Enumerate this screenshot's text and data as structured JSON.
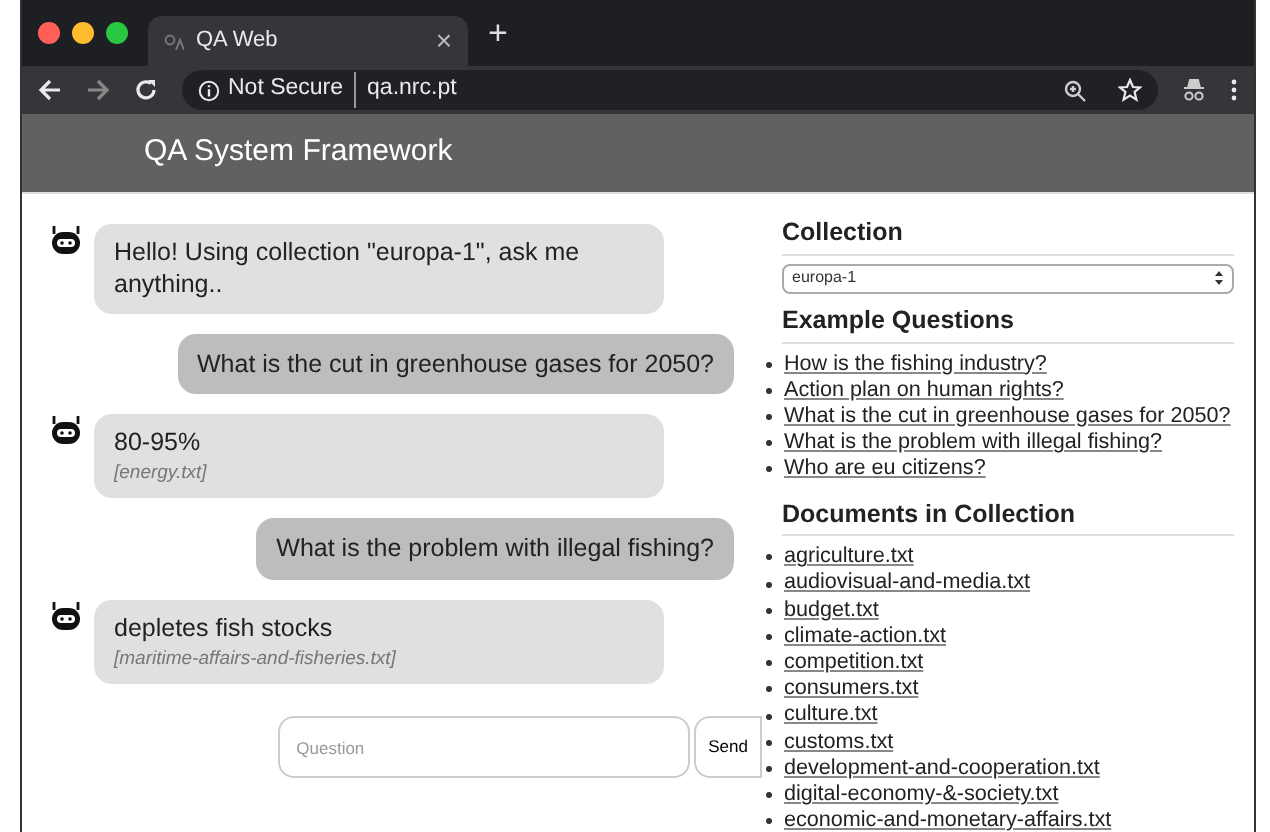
{
  "browser": {
    "tab_title": "QA Web",
    "tab_close": "×",
    "new_tab": "+",
    "security": "Not Secure",
    "url": "qa.nrc.pt"
  },
  "header": {
    "title": "QA System Framework"
  },
  "chat": {
    "messages": [
      {
        "kind": "bot",
        "text": "Hello! Using collection \"europa-1\", ask me anything.."
      },
      {
        "kind": "user",
        "text": "What is the cut in greenhouse gases for 2050?"
      },
      {
        "kind": "bot",
        "text": "80-95%",
        "source": "[energy.txt]"
      },
      {
        "kind": "user",
        "text": "What is the problem with illegal fishing?"
      },
      {
        "kind": "bot",
        "text": "depletes fish stocks",
        "source": "[maritime-affairs-and-fisheries.txt]"
      }
    ],
    "input": {
      "placeholder": "Question"
    },
    "send_button": "Send"
  },
  "sidebar": {
    "collection_heading": "Collection",
    "collection_value": "europa-1",
    "examples_heading": "Example Questions",
    "examples": [
      "How is the fishing industry?",
      "Action plan on human rights?",
      "What is the cut in greenhouse gases for 2050?",
      "What is the problem with illegal fishing?",
      "Who are eu citizens?"
    ],
    "documents_heading": "Documents in Collection",
    "documents": [
      "agriculture.txt",
      "audiovisual-and-media.txt",
      "budget.txt",
      "climate-action.txt",
      "competition.txt",
      "consumers.txt",
      "culture.txt",
      "customs.txt",
      "development-and-cooperation.txt",
      "digital-economy-&-society.txt",
      "economic-and-monetary-affairs.txt"
    ]
  }
}
